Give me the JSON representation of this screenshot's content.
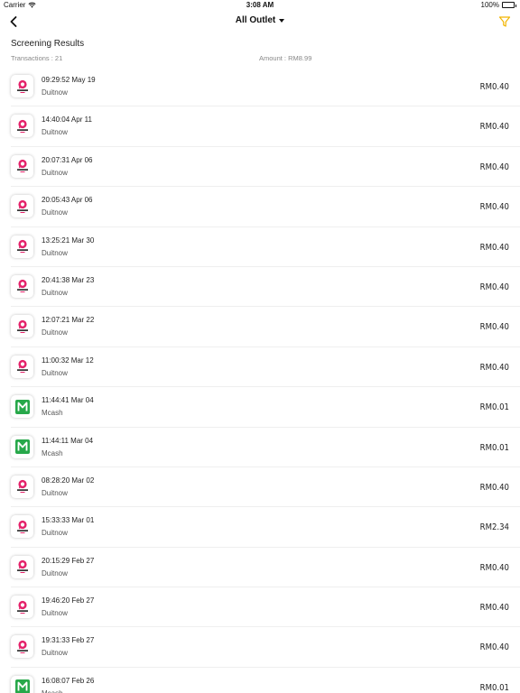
{
  "status_bar": {
    "carrier": "Carrier",
    "time": "3:08 AM",
    "battery": "100%"
  },
  "nav": {
    "title": "All Outlet"
  },
  "screening": {
    "title": "Screening Results",
    "transactions_label": "Transactions : 21",
    "amount_label": "Amount : RM8.99"
  },
  "colors": {
    "duitnow": "#e5236b",
    "mcash": "#27a84a",
    "filter": "#f2b500"
  },
  "transactions": [
    {
      "time": "09:29:52 May 19",
      "method": "Duitnow",
      "amount": "RM0.40",
      "icon": "duitnow-logo-icon"
    },
    {
      "time": "14:40:04 Apr 11",
      "method": "Duitnow",
      "amount": "RM0.40",
      "icon": "duitnow-logo-icon"
    },
    {
      "time": "20:07:31 Apr 06",
      "method": "Duitnow",
      "amount": "RM0.40",
      "icon": "duitnow-logo-icon"
    },
    {
      "time": "20:05:43 Apr 06",
      "method": "Duitnow",
      "amount": "RM0.40",
      "icon": "duitnow-logo-icon"
    },
    {
      "time": "13:25:21 Mar 30",
      "method": "Duitnow",
      "amount": "RM0.40",
      "icon": "duitnow-logo-icon"
    },
    {
      "time": "20:41:38 Mar 23",
      "method": "Duitnow",
      "amount": "RM0.40",
      "icon": "duitnow-logo-icon"
    },
    {
      "time": "12:07:21 Mar 22",
      "method": "Duitnow",
      "amount": "RM0.40",
      "icon": "duitnow-logo-icon"
    },
    {
      "time": "11:00:32 Mar 12",
      "method": "Duitnow",
      "amount": "RM0.40",
      "icon": "duitnow-logo-icon"
    },
    {
      "time": "11:44:41 Mar 04",
      "method": "Mcash",
      "amount": "RM0.01",
      "icon": "mcash-logo-icon"
    },
    {
      "time": "11:44:11 Mar 04",
      "method": "Mcash",
      "amount": "RM0.01",
      "icon": "mcash-logo-icon"
    },
    {
      "time": "08:28:20 Mar 02",
      "method": "Duitnow",
      "amount": "RM0.40",
      "icon": "duitnow-logo-icon"
    },
    {
      "time": "15:33:33 Mar 01",
      "method": "Duitnow",
      "amount": "RM2.34",
      "icon": "duitnow-logo-icon"
    },
    {
      "time": "20:15:29 Feb 27",
      "method": "Duitnow",
      "amount": "RM0.40",
      "icon": "duitnow-logo-icon"
    },
    {
      "time": "19:46:20 Feb 27",
      "method": "Duitnow",
      "amount": "RM0.40",
      "icon": "duitnow-logo-icon"
    },
    {
      "time": "19:31:33 Feb 27",
      "method": "Duitnow",
      "amount": "RM0.40",
      "icon": "duitnow-logo-icon"
    },
    {
      "time": "16:08:07 Feb 26",
      "method": "Mcash",
      "amount": "RM0.01",
      "icon": "mcash-logo-icon"
    }
  ]
}
